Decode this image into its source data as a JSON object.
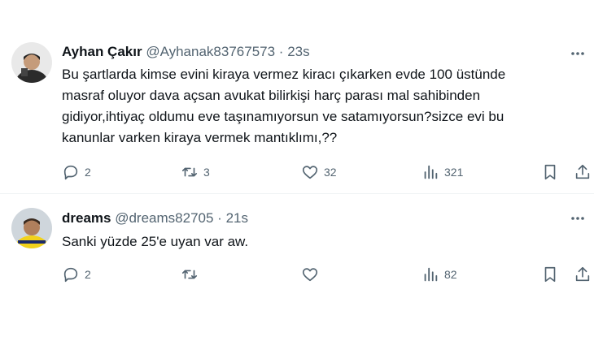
{
  "tweets": [
    {
      "name": "Ayhan Çakır",
      "handle": "@Ayhanak83767573",
      "separator": "·",
      "time": "23s",
      "text": "Bu şartlarda kimse evini kiraya vermez kiracı çıkarken evde 100 üstünde\nmasraf oluyor dava açsan avukat bilirkişi harç parası mal sahibinden\ngidiyor,ihtiyaç oldumu eve taşınamıyorsun ve satamıyorsun?sizce evi bu\nkanunlar varken kiraya vermek mantıklımı,??",
      "replies": "2",
      "retweets": "3",
      "likes": "32",
      "views": "321"
    },
    {
      "name": "dreams",
      "handle": "@dreams82705",
      "separator": "·",
      "time": "21s",
      "text": "Sanki yüzde 25'e uyan var aw.",
      "replies": "2",
      "retweets": "",
      "likes": "",
      "views": "82"
    }
  ],
  "icons": {
    "reply": "reply-icon",
    "retweet": "retweet-icon",
    "like": "heart-icon",
    "views": "views-icon",
    "bookmark": "bookmark-icon",
    "share": "share-icon",
    "more": "more-icon"
  },
  "colors": {
    "text": "#0f1419",
    "secondary": "#536471",
    "divider": "#eff3f4"
  }
}
